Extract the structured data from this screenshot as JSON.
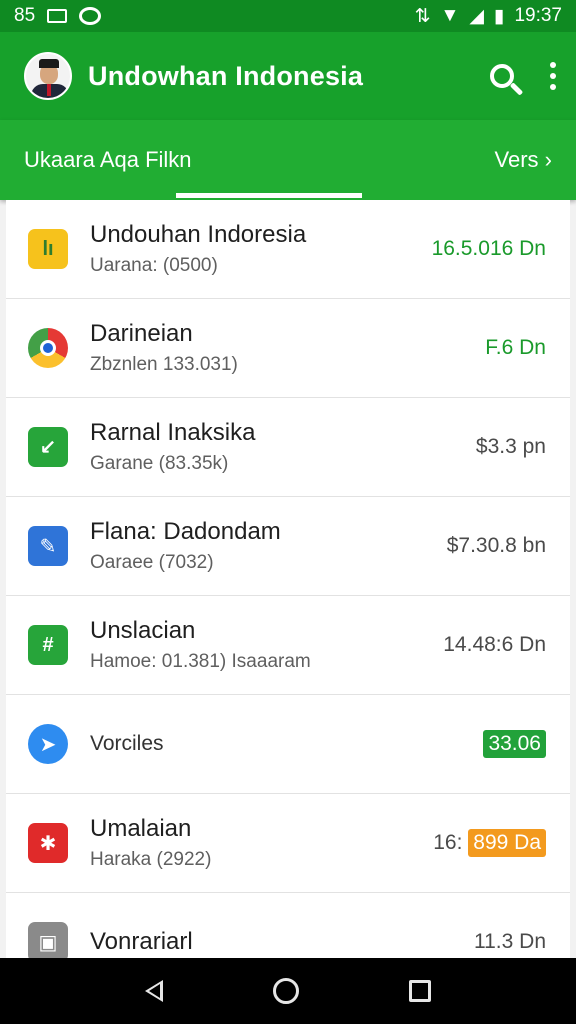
{
  "status_bar": {
    "left_text": "85",
    "time": "19:37"
  },
  "app_bar": {
    "title": "Undowhan Indonesia",
    "actions": [
      "search-icon",
      "more-vert-icon"
    ]
  },
  "tabs": {
    "label": "Ukaara Aqa Filkn",
    "more": "Vers ›"
  },
  "list": {
    "items": [
      {
        "title": "Undouhan Indoresia",
        "subtitle": "Uarana: (0500)",
        "value": "16.5.016 Dn",
        "value_color": "#1a9a2b",
        "icon": "yellow-app-icon"
      },
      {
        "title": "Darineian",
        "subtitle": "Zbznlen 133.031)",
        "value": "F.6 Dn",
        "value_color": "#1a9a2b",
        "icon": "chrome-icon"
      },
      {
        "title": "Rarnal Inaksika",
        "subtitle": "Garane (83.35k)",
        "value": "$3.3 pn",
        "icon": "green-app-icon"
      },
      {
        "title": "Flana: Dadondam",
        "subtitle": "Oaraee (7032)",
        "value": "$7.30.8 bn",
        "icon": "blue-edit-icon"
      },
      {
        "title": "Unslacian",
        "subtitle": "Hamoe: 01.381) Isaaaram",
        "value": "14.48:6 Dn",
        "icon": "green-hashtag-icon"
      },
      {
        "title": "Vorciles",
        "subtitle": "",
        "value": "33.06",
        "badge": "green",
        "icon": "blue-arrow-icon"
      },
      {
        "title": "Umalaian",
        "subtitle": "Haraka (2922)",
        "value_prefix": "16:",
        "value": "899 Da",
        "badge": "orange",
        "icon": "red-app-icon"
      },
      {
        "title": "Vonrariarl",
        "subtitle": "",
        "value": "11.3 Dn",
        "icon": "gray-app-icon"
      }
    ]
  },
  "nav_bar": [
    "back-icon",
    "home-icon",
    "recents-icon"
  ],
  "colors": {
    "status_bar": "#0f8a22",
    "app_bar": "#17a12b",
    "tab_bar": "#21ad33",
    "accent_green": "#1a9a2b",
    "badge_orange": "#f39a1e"
  }
}
